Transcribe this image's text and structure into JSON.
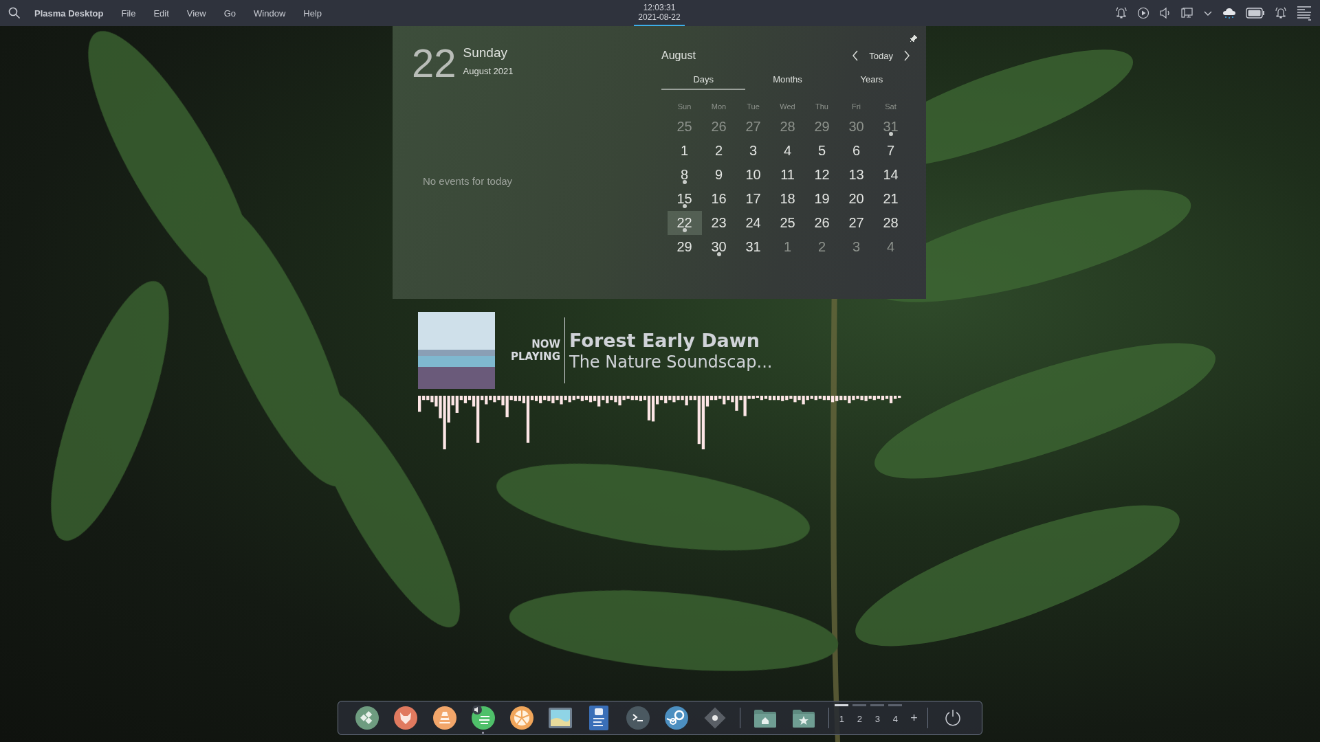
{
  "top_bar": {
    "app_name": "Plasma Desktop",
    "menu": [
      "File",
      "Edit",
      "View",
      "Go",
      "Window",
      "Help"
    ],
    "clock": {
      "time": "12:03:31",
      "date": "2021-08-22",
      "expanded": true
    }
  },
  "calendar_popup": {
    "day_number": "22",
    "weekday": "Sunday",
    "month_year": "August 2021",
    "events_message": "No events for today",
    "month": "August",
    "today_button": "Today",
    "tabs": [
      {
        "label": "Days",
        "selected": true
      },
      {
        "label": "Months",
        "selected": false
      },
      {
        "label": "Years",
        "selected": false
      }
    ],
    "weekdays": [
      "Sun",
      "Mon",
      "Tue",
      "Wed",
      "Thu",
      "Fri",
      "Sat"
    ],
    "weeks": [
      [
        {
          "label": "25",
          "muted": true,
          "event": false,
          "selected": false
        },
        {
          "label": "26",
          "muted": true,
          "event": false,
          "selected": false
        },
        {
          "label": "27",
          "muted": true,
          "event": false,
          "selected": false
        },
        {
          "label": "28",
          "muted": true,
          "event": false,
          "selected": false
        },
        {
          "label": "29",
          "muted": true,
          "event": false,
          "selected": false
        },
        {
          "label": "30",
          "muted": true,
          "event": false,
          "selected": false
        },
        {
          "label": "31",
          "muted": true,
          "event": true,
          "selected": false
        }
      ],
      [
        {
          "label": "1",
          "muted": false,
          "event": false,
          "selected": false
        },
        {
          "label": "2",
          "muted": false,
          "event": false,
          "selected": false
        },
        {
          "label": "3",
          "muted": false,
          "event": false,
          "selected": false
        },
        {
          "label": "4",
          "muted": false,
          "event": false,
          "selected": false
        },
        {
          "label": "5",
          "muted": false,
          "event": false,
          "selected": false
        },
        {
          "label": "6",
          "muted": false,
          "event": false,
          "selected": false
        },
        {
          "label": "7",
          "muted": false,
          "event": false,
          "selected": false
        }
      ],
      [
        {
          "label": "8",
          "muted": false,
          "event": true,
          "selected": false
        },
        {
          "label": "9",
          "muted": false,
          "event": false,
          "selected": false
        },
        {
          "label": "10",
          "muted": false,
          "event": false,
          "selected": false
        },
        {
          "label": "11",
          "muted": false,
          "event": false,
          "selected": false
        },
        {
          "label": "12",
          "muted": false,
          "event": false,
          "selected": false
        },
        {
          "label": "13",
          "muted": false,
          "event": false,
          "selected": false
        },
        {
          "label": "14",
          "muted": false,
          "event": false,
          "selected": false
        }
      ],
      [
        {
          "label": "15",
          "muted": false,
          "event": true,
          "selected": false
        },
        {
          "label": "16",
          "muted": false,
          "event": false,
          "selected": false
        },
        {
          "label": "17",
          "muted": false,
          "event": false,
          "selected": false
        },
        {
          "label": "18",
          "muted": false,
          "event": false,
          "selected": false
        },
        {
          "label": "19",
          "muted": false,
          "event": false,
          "selected": false
        },
        {
          "label": "20",
          "muted": false,
          "event": false,
          "selected": false
        },
        {
          "label": "21",
          "muted": false,
          "event": false,
          "selected": false
        }
      ],
      [
        {
          "label": "22",
          "muted": false,
          "event": true,
          "selected": true
        },
        {
          "label": "23",
          "muted": false,
          "event": false,
          "selected": false
        },
        {
          "label": "24",
          "muted": false,
          "event": false,
          "selected": false
        },
        {
          "label": "25",
          "muted": false,
          "event": false,
          "selected": false
        },
        {
          "label": "26",
          "muted": false,
          "event": false,
          "selected": false
        },
        {
          "label": "27",
          "muted": false,
          "event": false,
          "selected": false
        },
        {
          "label": "28",
          "muted": false,
          "event": false,
          "selected": false
        }
      ],
      [
        {
          "label": "29",
          "muted": false,
          "event": false,
          "selected": false
        },
        {
          "label": "30",
          "muted": false,
          "event": true,
          "selected": false
        },
        {
          "label": "31",
          "muted": false,
          "event": false,
          "selected": false
        },
        {
          "label": "1",
          "muted": true,
          "event": false,
          "selected": false
        },
        {
          "label": "2",
          "muted": true,
          "event": false,
          "selected": false
        },
        {
          "label": "3",
          "muted": true,
          "event": false,
          "selected": false
        },
        {
          "label": "4",
          "muted": true,
          "event": false,
          "selected": false
        }
      ]
    ]
  },
  "now_playing": {
    "label": "NOW PLAYING",
    "title": "Forest Early Dawn",
    "artist": "The Nature Soundscap..."
  },
  "dock": {
    "launchers": [
      {
        "kind": "tiles",
        "color": "#6e9c80",
        "running": false
      },
      {
        "kind": "fox",
        "color": "#e07a5f",
        "running": false
      },
      {
        "kind": "cone",
        "color": "#f2a66a",
        "running": false
      },
      {
        "kind": "music",
        "color": "#4fc06a",
        "running": true
      },
      {
        "kind": "citrus",
        "color": "#f0a55a",
        "running": false
      },
      {
        "kind": "image",
        "color": "#6f7f8f",
        "running": false
      },
      {
        "kind": "document",
        "color": "#3a6fb8",
        "running": false
      },
      {
        "kind": "terminal",
        "color": "#4b5961",
        "running": false
      },
      {
        "kind": "steam",
        "color": "#4c8fc0",
        "running": false
      },
      {
        "kind": "settings",
        "color": "#5a5f66",
        "running": false
      }
    ],
    "places": [
      {
        "kind": "home"
      },
      {
        "kind": "star"
      }
    ],
    "desktops": [
      {
        "label": "1",
        "selected": true
      },
      {
        "label": "2",
        "selected": false
      },
      {
        "label": "3",
        "selected": false
      },
      {
        "label": "4",
        "selected": false
      }
    ],
    "add_desktop": "+"
  }
}
